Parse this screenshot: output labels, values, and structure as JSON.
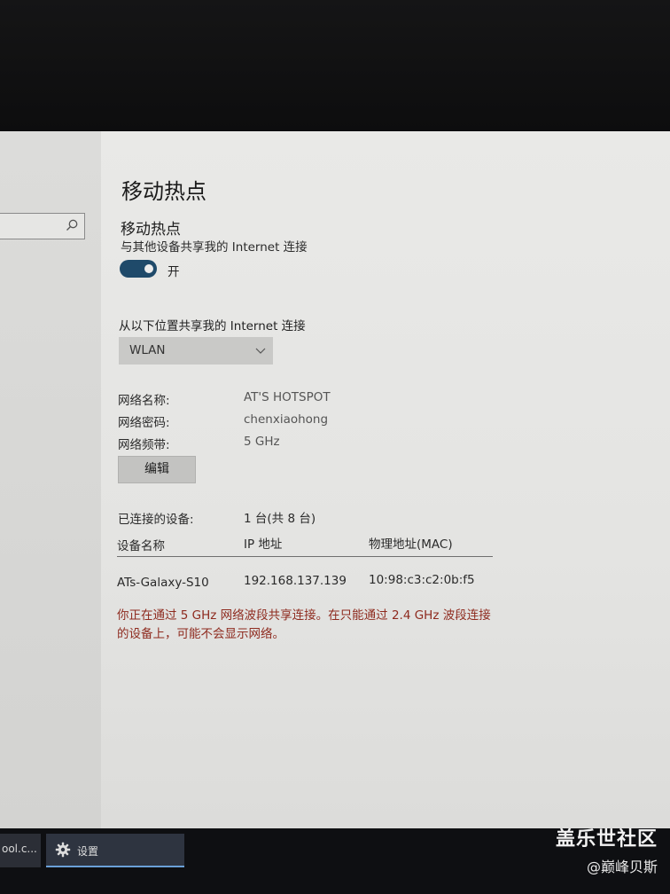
{
  "page": {
    "title": "移动热点",
    "hotspot_section": {
      "title": "移动热点",
      "subtitle": "与其他设备共享我的 Internet 连接",
      "toggle_state": "on",
      "toggle_label": "开"
    },
    "share_from": {
      "label": "从以下位置共享我的 Internet 连接",
      "selected": "WLAN"
    },
    "network_properties": [
      {
        "label": "网络名称:",
        "value": "AT'S HOTSPOT"
      },
      {
        "label": "网络密码:",
        "value": "chenxiaohong"
      },
      {
        "label": "网络频带:",
        "value": "5 GHz"
      }
    ],
    "edit_button_label": "编辑",
    "connected_devices": {
      "label": "已连接的设备:",
      "count_text": "1 台(共 8 台)",
      "columns": [
        "设备名称",
        "IP 地址",
        "物理地址(MAC)"
      ],
      "rows": [
        [
          "ATs-Galaxy-S10",
          "192.168.137.139",
          "10:98:c3:c2:0b:f5"
        ]
      ]
    },
    "warning": "你正在通过 5 GHz 网络波段共享连接。在只能通过 2.4 GHz 波段连接的设备上，可能不会显示网络。"
  },
  "taskbar": {
    "left_item_label": "ool.c...",
    "settings_label": "设置"
  },
  "watermark": {
    "line1": "盖乐世社区",
    "line2": "@巅峰贝斯"
  },
  "colors": {
    "toggle_on": "#1f4a6a",
    "warning_text": "#8e2a1e",
    "taskbar_accent": "#6aa0d8"
  }
}
